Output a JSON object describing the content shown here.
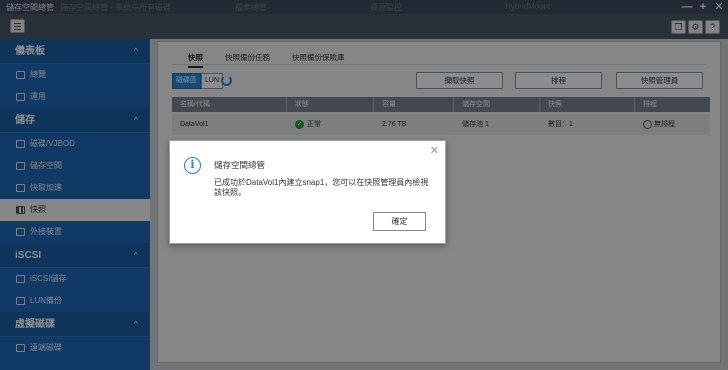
{
  "window": {
    "title": "儲存空間總管",
    "ghost_titles": [
      "儲存空間總管 - 系統中所有磁碟",
      "檔案總管",
      "資源監控",
      "HybridMount"
    ],
    "controls": [
      "—",
      "+",
      "✕"
    ]
  },
  "sidebar": {
    "sections": [
      {
        "label": "儀表板",
        "items": [
          {
            "label": "總覽",
            "icon": "overview-icon"
          },
          {
            "label": "運用",
            "icon": "utilization-icon"
          }
        ]
      },
      {
        "label": "儲存",
        "items": [
          {
            "label": "磁碟/VJBOD",
            "icon": "disk-icon"
          },
          {
            "label": "儲存空間",
            "icon": "storage-space-icon"
          },
          {
            "label": "快取加速",
            "icon": "cache-icon"
          },
          {
            "label": "快照",
            "icon": "snapshot-icon",
            "active": true
          },
          {
            "label": "外接裝置",
            "icon": "external-device-icon"
          }
        ]
      },
      {
        "label": "iSCSI",
        "items": [
          {
            "label": "iSCSI儲存",
            "icon": "iscsi-storage-icon"
          },
          {
            "label": "LUN備份",
            "icon": "lun-backup-icon"
          }
        ]
      },
      {
        "label": "虛擬磁碟",
        "items": [
          {
            "label": "遠端磁碟",
            "icon": "remote-disk-icon"
          }
        ]
      }
    ]
  },
  "main": {
    "tabs": [
      "快照",
      "快照備份任務",
      "快照備份保險庫"
    ],
    "segments": [
      "磁碟區",
      "LUN"
    ],
    "buttons": {
      "take_snapshot": "擷取快照",
      "schedule": "排程",
      "snapshot_manager": "快照管理員"
    },
    "table": {
      "headers": [
        "名稱/代稱",
        "狀態",
        "容量",
        "儲存空間",
        "快照",
        "排程"
      ],
      "row": {
        "name": "DataVol1",
        "status": "正常",
        "capacity": "2.76 TB",
        "pool": "儲存池 1",
        "snapshots": "數目：1",
        "schedule": "無排程"
      }
    }
  },
  "dialog": {
    "title": "儲存空間總管",
    "message": "已成功於DataVol1內建立snap1，您可以在快照管理員內檢視該快照。",
    "ok": "確定"
  }
}
